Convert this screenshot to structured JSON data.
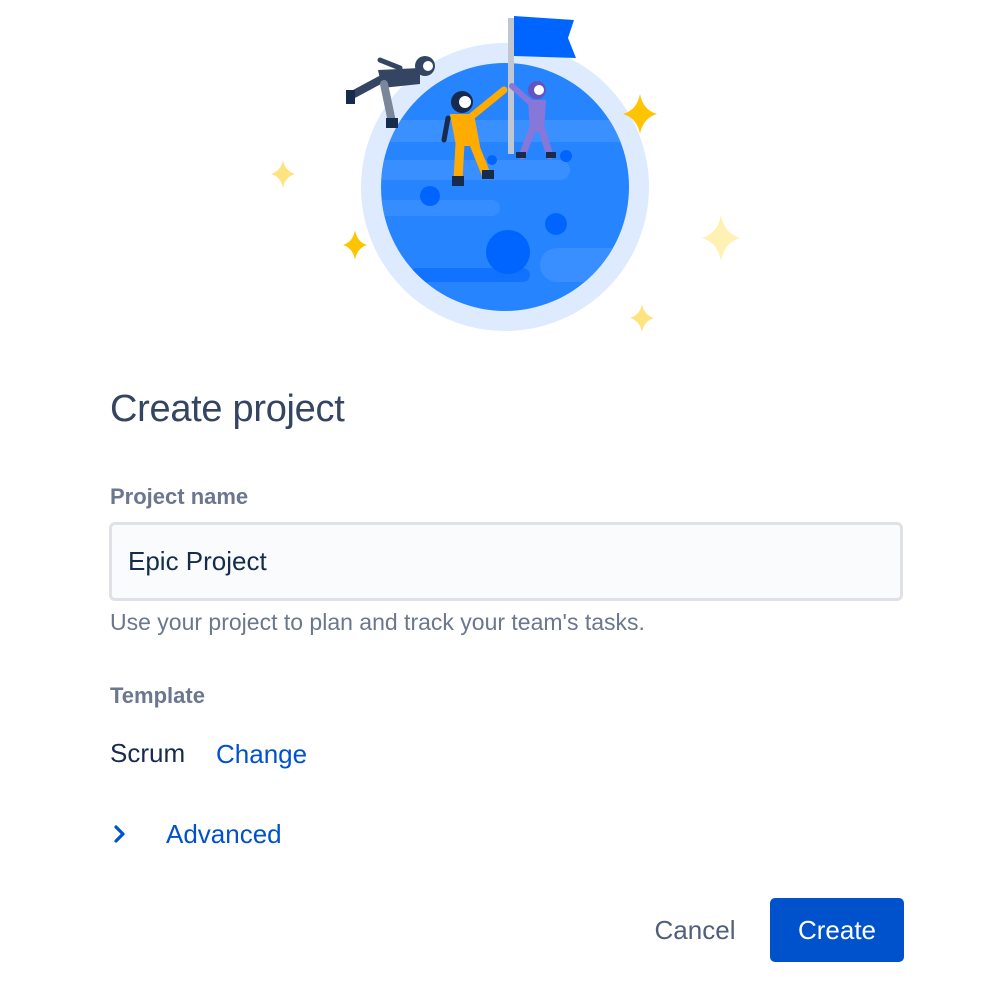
{
  "dialog": {
    "title": "Create project"
  },
  "project_name": {
    "label": "Project name",
    "value": "Epic Project",
    "helper": "Use your project to plan and track your team's tasks."
  },
  "template": {
    "label": "Template",
    "value": "Scrum",
    "change_label": "Change"
  },
  "advanced": {
    "label": "Advanced",
    "icon": "chevron-right-icon"
  },
  "actions": {
    "cancel_label": "Cancel",
    "create_label": "Create"
  },
  "illustration": {
    "icon": "planet-flag-illustration"
  },
  "colors": {
    "primary": "#0052cc",
    "heading": "#344563",
    "label": "#6b778c",
    "text": "#172b4d",
    "planet": "#2684ff",
    "star": "#ffc400"
  }
}
